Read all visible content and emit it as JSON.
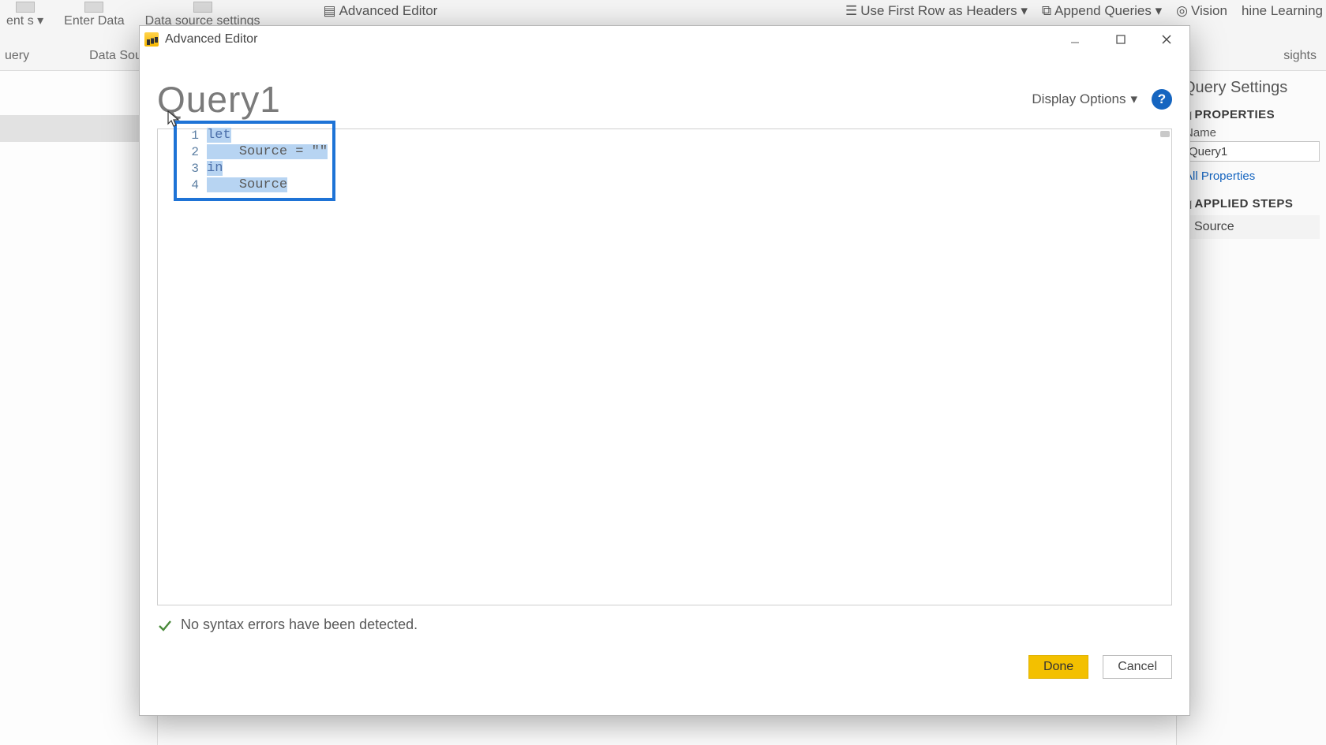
{
  "ribbon": {
    "items": [
      {
        "label": "ent\ns ▾"
      },
      {
        "label": "Enter\nData"
      },
      {
        "label": "Data source\nsettings"
      }
    ],
    "right_items": [
      "Advanced Editor",
      "Use First Row as Headers ▾",
      "Append Queries ▾",
      "Vision",
      "hine Learning"
    ],
    "groups": [
      "uery",
      "Data Sources",
      "sights"
    ]
  },
  "settings": {
    "panel_title": "Query Settings",
    "properties_hdr": "PROPERTIES",
    "name_label": "Name",
    "name_value": "Query1",
    "all_properties": "All Properties",
    "applied_steps_hdr": "APPLIED STEPS",
    "steps": [
      "Source"
    ]
  },
  "dialog": {
    "title": "Advanced Editor",
    "query_title": "Query1",
    "display_options": "Display Options",
    "help_glyph": "?",
    "code": {
      "lines": [
        {
          "n": "1",
          "pre_kw": "",
          "kw": "let",
          "rest": ""
        },
        {
          "n": "2",
          "pre_kw": "    ",
          "kw": "",
          "rest": "Source = \"\""
        },
        {
          "n": "3",
          "pre_kw": "",
          "kw": "in",
          "rest": ""
        },
        {
          "n": "4",
          "pre_kw": "    ",
          "kw": "",
          "rest": "Source"
        }
      ]
    },
    "status": "No syntax errors have been detected.",
    "done": "Done",
    "cancel": "Cancel"
  }
}
